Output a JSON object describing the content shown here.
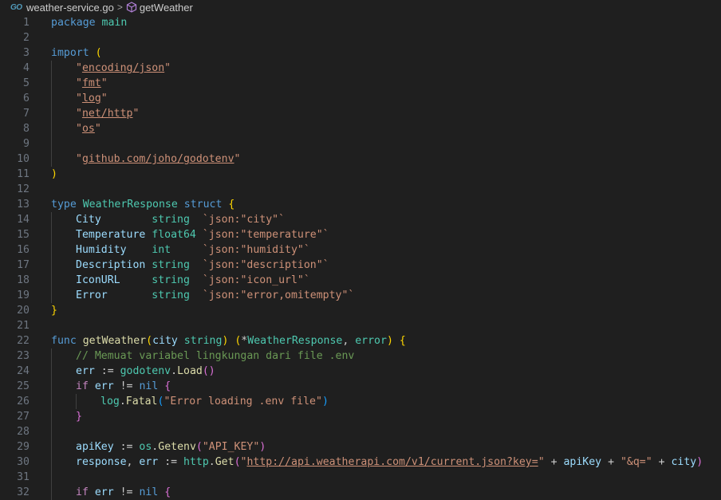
{
  "breadcrumb": {
    "file_icon": "go-file-icon",
    "file_icon_text": "GO",
    "file": "weather-service.go",
    "separator": ">",
    "symbol_icon": "method-cube-icon",
    "symbol": "getWeather"
  },
  "colors": {
    "background": "#1f1f1f",
    "keyword": "#569cd6",
    "type": "#4ec9b0",
    "function": "#dcdcaa",
    "variable": "#9cdcfe",
    "string": "#ce9178",
    "comment": "#6a9955",
    "bracket_gold": "#ffd700",
    "bracket_purple": "#da70d6",
    "bracket_blue": "#179fff"
  },
  "lines": [
    {
      "n": "1",
      "tokens": [
        [
          "kw",
          "package"
        ],
        [
          "punc",
          " "
        ],
        [
          "ty",
          "main"
        ]
      ]
    },
    {
      "n": "2",
      "tokens": []
    },
    {
      "n": "3",
      "tokens": [
        [
          "kw",
          "import"
        ],
        [
          "punc",
          " "
        ],
        [
          "br1",
          "("
        ]
      ]
    },
    {
      "n": "4",
      "indent": 1,
      "tokens": [
        [
          "str",
          "\""
        ],
        [
          "str ul",
          "encoding/json"
        ],
        [
          "str",
          "\""
        ]
      ]
    },
    {
      "n": "5",
      "indent": 1,
      "tokens": [
        [
          "str",
          "\""
        ],
        [
          "str ul",
          "fmt"
        ],
        [
          "str",
          "\""
        ]
      ]
    },
    {
      "n": "6",
      "indent": 1,
      "tokens": [
        [
          "str",
          "\""
        ],
        [
          "str ul",
          "log"
        ],
        [
          "str",
          "\""
        ]
      ]
    },
    {
      "n": "7",
      "indent": 1,
      "tokens": [
        [
          "str",
          "\""
        ],
        [
          "str ul",
          "net/http"
        ],
        [
          "str",
          "\""
        ]
      ]
    },
    {
      "n": "8",
      "indent": 1,
      "tokens": [
        [
          "str",
          "\""
        ],
        [
          "str ul",
          "os"
        ],
        [
          "str",
          "\""
        ]
      ]
    },
    {
      "n": "9",
      "indent": 1,
      "tokens": []
    },
    {
      "n": "10",
      "indent": 1,
      "tokens": [
        [
          "str",
          "\""
        ],
        [
          "str ul",
          "github.com/joho/godotenv"
        ],
        [
          "str",
          "\""
        ]
      ]
    },
    {
      "n": "11",
      "tokens": [
        [
          "br1",
          ")"
        ]
      ]
    },
    {
      "n": "12",
      "tokens": []
    },
    {
      "n": "13",
      "tokens": [
        [
          "kw",
          "type"
        ],
        [
          "punc",
          " "
        ],
        [
          "ty",
          "WeatherResponse"
        ],
        [
          "punc",
          " "
        ],
        [
          "kw",
          "struct"
        ],
        [
          "punc",
          " "
        ],
        [
          "br1",
          "{"
        ]
      ]
    },
    {
      "n": "14",
      "indent": 1,
      "tokens": [
        [
          "var",
          "City"
        ],
        [
          "punc",
          "        "
        ],
        [
          "ty",
          "string"
        ],
        [
          "punc",
          "  "
        ],
        [
          "tag",
          "`json:\"city\"`"
        ]
      ]
    },
    {
      "n": "15",
      "indent": 1,
      "tokens": [
        [
          "var",
          "Temperature"
        ],
        [
          "punc",
          " "
        ],
        [
          "ty",
          "float64"
        ],
        [
          "punc",
          " "
        ],
        [
          "tag",
          "`json:\"temperature\"`"
        ]
      ]
    },
    {
      "n": "16",
      "indent": 1,
      "tokens": [
        [
          "var",
          "Humidity"
        ],
        [
          "punc",
          "    "
        ],
        [
          "ty",
          "int"
        ],
        [
          "punc",
          "     "
        ],
        [
          "tag",
          "`json:\"humidity\"`"
        ]
      ]
    },
    {
      "n": "17",
      "indent": 1,
      "tokens": [
        [
          "var",
          "Description"
        ],
        [
          "punc",
          " "
        ],
        [
          "ty",
          "string"
        ],
        [
          "punc",
          "  "
        ],
        [
          "tag",
          "`json:\"description\"`"
        ]
      ]
    },
    {
      "n": "18",
      "indent": 1,
      "tokens": [
        [
          "var",
          "IconURL"
        ],
        [
          "punc",
          "     "
        ],
        [
          "ty",
          "string"
        ],
        [
          "punc",
          "  "
        ],
        [
          "tag",
          "`json:\"icon_url\"`"
        ]
      ]
    },
    {
      "n": "19",
      "indent": 1,
      "tokens": [
        [
          "var",
          "Error"
        ],
        [
          "punc",
          "       "
        ],
        [
          "ty",
          "string"
        ],
        [
          "punc",
          "  "
        ],
        [
          "tag",
          "`json:\"error,omitempty\"`"
        ]
      ]
    },
    {
      "n": "20",
      "tokens": [
        [
          "br1",
          "}"
        ]
      ]
    },
    {
      "n": "21",
      "tokens": []
    },
    {
      "n": "22",
      "tokens": [
        [
          "kw",
          "func"
        ],
        [
          "punc",
          " "
        ],
        [
          "fn",
          "getWeather"
        ],
        [
          "br1",
          "("
        ],
        [
          "var",
          "city"
        ],
        [
          "punc",
          " "
        ],
        [
          "ty",
          "string"
        ],
        [
          "br1",
          ")"
        ],
        [
          "punc",
          " "
        ],
        [
          "br1",
          "("
        ],
        [
          "punc",
          "*"
        ],
        [
          "ty",
          "WeatherResponse"
        ],
        [
          "punc",
          ", "
        ],
        [
          "ty",
          "error"
        ],
        [
          "br1",
          ")"
        ],
        [
          "punc",
          " "
        ],
        [
          "br1",
          "{"
        ]
      ]
    },
    {
      "n": "23",
      "indent": 1,
      "tokens": [
        [
          "cm",
          "// Memuat variabel lingkungan dari file .env"
        ]
      ]
    },
    {
      "n": "24",
      "indent": 1,
      "tokens": [
        [
          "var",
          "err"
        ],
        [
          "punc",
          " := "
        ],
        [
          "ty",
          "godotenv"
        ],
        [
          "punc",
          "."
        ],
        [
          "fn",
          "Load"
        ],
        [
          "br2",
          "()"
        ]
      ]
    },
    {
      "n": "25",
      "indent": 1,
      "tokens": [
        [
          "ctl",
          "if"
        ],
        [
          "punc",
          " "
        ],
        [
          "var",
          "err"
        ],
        [
          "punc",
          " != "
        ],
        [
          "kw",
          "nil"
        ],
        [
          "punc",
          " "
        ],
        [
          "br2",
          "{"
        ]
      ]
    },
    {
      "n": "26",
      "indent": 2,
      "tokens": [
        [
          "ty",
          "log"
        ],
        [
          "punc",
          "."
        ],
        [
          "fn",
          "Fatal"
        ],
        [
          "br3",
          "("
        ],
        [
          "str",
          "\"Error loading .env file\""
        ],
        [
          "br3",
          ")"
        ]
      ]
    },
    {
      "n": "27",
      "indent": 1,
      "tokens": [
        [
          "br2",
          "}"
        ]
      ]
    },
    {
      "n": "28",
      "indent": 1,
      "tokens": []
    },
    {
      "n": "29",
      "indent": 1,
      "tokens": [
        [
          "var",
          "apiKey"
        ],
        [
          "punc",
          " := "
        ],
        [
          "ty",
          "os"
        ],
        [
          "punc",
          "."
        ],
        [
          "fn",
          "Getenv"
        ],
        [
          "br2",
          "("
        ],
        [
          "str",
          "\"API_KEY\""
        ],
        [
          "br2",
          ")"
        ]
      ]
    },
    {
      "n": "30",
      "indent": 1,
      "tokens": [
        [
          "var",
          "response"
        ],
        [
          "punc",
          ", "
        ],
        [
          "var",
          "err"
        ],
        [
          "punc",
          " := "
        ],
        [
          "ty",
          "http"
        ],
        [
          "punc",
          "."
        ],
        [
          "fn",
          "Get"
        ],
        [
          "br2",
          "("
        ],
        [
          "str",
          "\""
        ],
        [
          "str ul",
          "http://api.weatherapi.com/v1/current.json?key="
        ],
        [
          "str",
          "\""
        ],
        [
          "punc",
          " + "
        ],
        [
          "var",
          "apiKey"
        ],
        [
          "punc",
          " + "
        ],
        [
          "str",
          "\"&q=\""
        ],
        [
          "punc",
          " + "
        ],
        [
          "var",
          "city"
        ],
        [
          "br2",
          ")"
        ]
      ]
    },
    {
      "n": "31",
      "indent": 1,
      "tokens": []
    },
    {
      "n": "32",
      "indent": 1,
      "tokens": [
        [
          "ctl",
          "if"
        ],
        [
          "punc",
          " "
        ],
        [
          "var",
          "err"
        ],
        [
          "punc",
          " != "
        ],
        [
          "kw",
          "nil"
        ],
        [
          "punc",
          " "
        ],
        [
          "br2",
          "{"
        ]
      ]
    }
  ]
}
